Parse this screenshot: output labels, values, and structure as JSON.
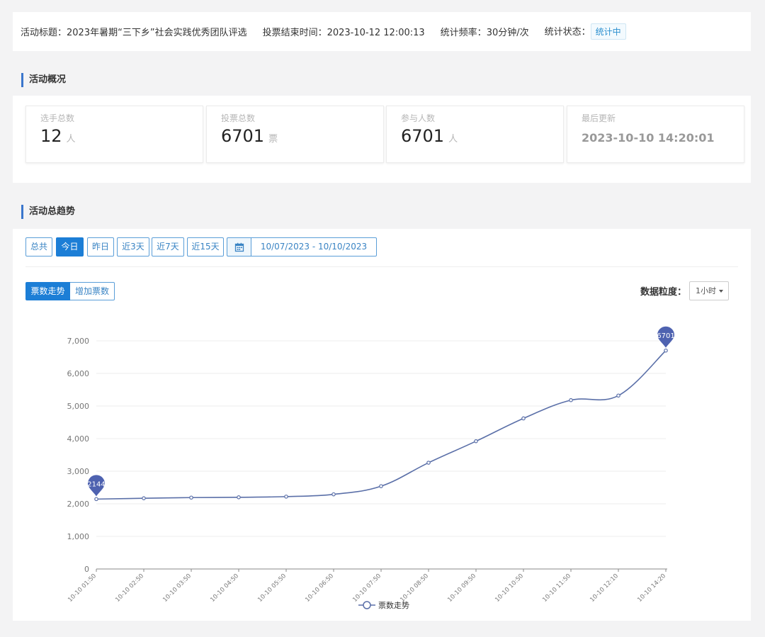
{
  "activity": {
    "title_label": "活动标题：",
    "title": "2023年暑期“三下乡”社会实践优秀团队评选",
    "end_label": "投票结束时间：",
    "end_time": "2023-10-12 12:00:13",
    "freq_label": "统计频率：",
    "freq": "30分钟/次",
    "status_label": "统计状态：",
    "status": "统计中"
  },
  "overview": {
    "section_title": "活动概况",
    "cards": [
      {
        "label": "选手总数",
        "value": "12",
        "unit": "人"
      },
      {
        "label": "投票总数",
        "value": "6701",
        "unit": "票"
      },
      {
        "label": "参与人数",
        "value": "6701",
        "unit": "人"
      },
      {
        "label": "最后更新",
        "value": "2023-10-10 14:20:01",
        "unit": ""
      }
    ]
  },
  "trend": {
    "section_title": "活动总趋势",
    "ranges": [
      "总共",
      "今日",
      "昨日",
      "近3天",
      "近7天",
      "近15天"
    ],
    "active_range": "今日",
    "date_range": "10/07/2023 - 10/10/2023",
    "modes": [
      "票数走势",
      "增加票数"
    ],
    "active_mode": "票数走势",
    "granularity_label": "数据粒度：",
    "granularity_value": "1小时"
  },
  "colors": {
    "accent": "#1c7ed6",
    "line": "#5a6fa8",
    "pin": "#4e62b0"
  },
  "icons": {
    "calendar": "calendar-icon",
    "dropdown": "chevron-down-icon"
  },
  "chart_data": {
    "type": "line",
    "x": [
      "10-10 01:50",
      "10-10 02:50",
      "10-10 03:50",
      "10-10 04:50",
      "10-10 05:50",
      "10-10 06:50",
      "10-10 07:50",
      "10-10 08:50",
      "10-10 09:50",
      "10-10 10:50",
      "10-10 11:50",
      "10-10 12:10",
      "10-10 14:20"
    ],
    "series": [
      {
        "name": "票数走势",
        "values": [
          2144,
          2170,
          2190,
          2200,
          2220,
          2290,
          2540,
          3260,
          3920,
          4620,
          5180,
          5320,
          6701
        ]
      }
    ],
    "ylim": [
      0,
      7000
    ],
    "yticks": [
      0,
      1000,
      2000,
      3000,
      4000,
      5000,
      6000,
      7000
    ],
    "ytick_labels": [
      "0",
      "1,000",
      "2,000",
      "3,000",
      "4,000",
      "5,000",
      "6,000",
      "7,000"
    ],
    "markers": [
      {
        "label": "2144",
        "index": 0
      },
      {
        "label": "6701",
        "index": 12
      }
    ],
    "legend": "bottom-center",
    "grid": true
  }
}
